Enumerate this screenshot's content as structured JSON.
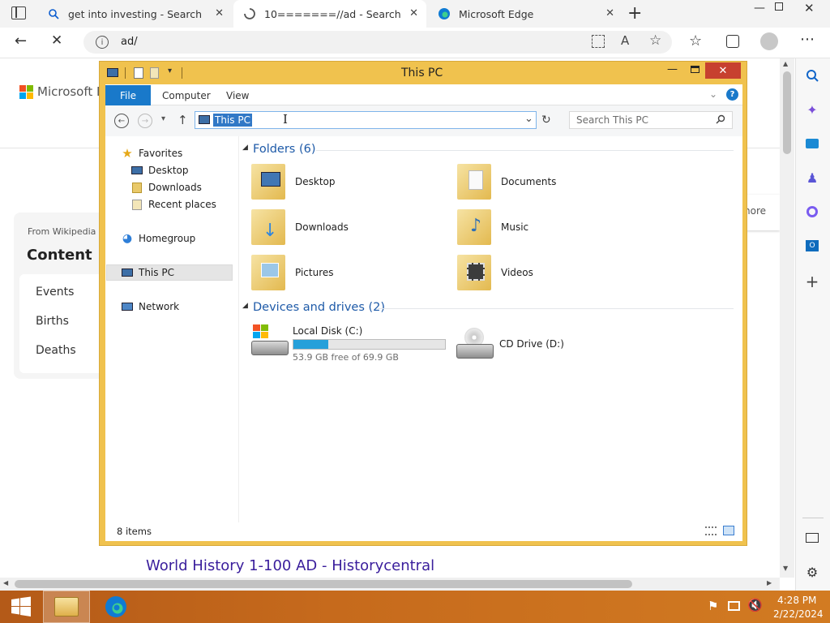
{
  "browser": {
    "tabs": [
      {
        "label": "get into investing - Search"
      },
      {
        "label": "10=======//ad - Search"
      },
      {
        "label": "Microsoft Edge"
      }
    ],
    "url": "ad/"
  },
  "page": {
    "logo_text": "Microsoft Bi",
    "wiki_source": "From Wikipedia",
    "wiki_heading": "Content",
    "wiki_items": [
      "Events",
      "Births",
      "Deaths"
    ],
    "more_text": "nore",
    "result_link": "World History 1-100 AD - Historycentral"
  },
  "explorer": {
    "title": "This PC",
    "ribbon_tabs": {
      "file": "File",
      "computer": "Computer",
      "view": "View"
    },
    "address": "This PC",
    "search_placeholder": "Search This PC",
    "nav": {
      "favorites": "Favorites",
      "desktop": "Desktop",
      "downloads": "Downloads",
      "recent": "Recent places",
      "homegroup": "Homegroup",
      "thispc": "This PC",
      "network": "Network"
    },
    "folders_header": "Folders (6)",
    "folders": [
      "Desktop",
      "Documents",
      "Downloads",
      "Music",
      "Pictures",
      "Videos"
    ],
    "drives_header": "Devices and drives (2)",
    "drives": [
      {
        "name": "Local Disk (C:)",
        "free": "53.9 GB free of 69.9 GB",
        "used_fraction": 0.229
      },
      {
        "name": "CD Drive (D:)"
      }
    ],
    "status": "8 items"
  },
  "taskbar": {
    "time": "4:28 PM",
    "date": "2/22/2024"
  },
  "colors": {
    "explorer_frame": "#f0c24e",
    "file_tab": "#1979ca",
    "link": "#3a1e9c",
    "taskbar": "#c66a1c"
  }
}
